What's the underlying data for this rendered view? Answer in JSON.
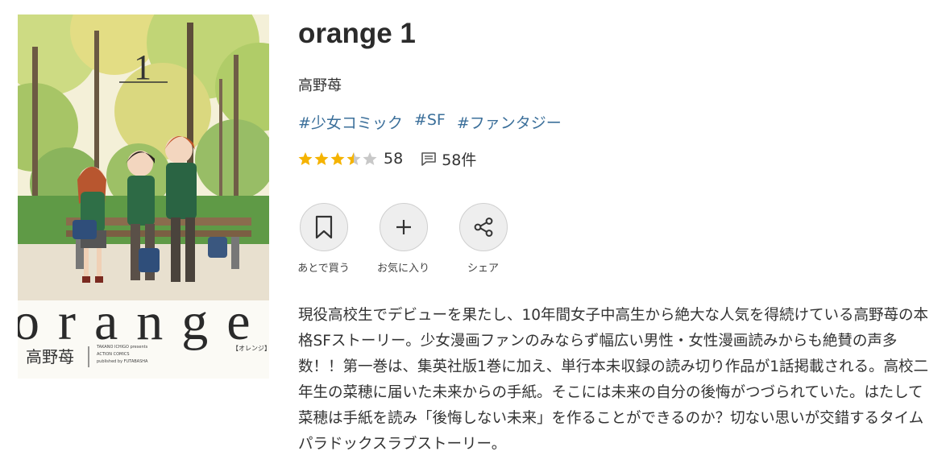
{
  "book": {
    "title": "orange 1",
    "author": "高野苺",
    "tags": [
      "#少女コミック",
      "#SF",
      "#ファンタジー"
    ],
    "rating": 3.5,
    "rating_count": "58",
    "review_count": "58件",
    "description": "現役高校生でデビューを果たし、10年間女子中高生から絶大な人気を得続けている高野苺の本格SFストーリー。少女漫画ファンのみならず幅広い男性・女性漫画読みからも絶賛の声多数！！第一巻は、集英社版1巻に加え、単行本未収録の読み切り作品が1話掲載される。高校二年生の菜穂に届いた未来からの手紙。そこには未来の自分の後悔がつづられていた。はたして菜穂は手紙を読み「後悔しない未来」を作ることができるのか？切ない思いが交錯するタイムパラドックスラブストーリー。"
  },
  "cover": {
    "volume_number": "1",
    "logo": "orange",
    "subtitle": "【オレンジ】",
    "author_name": "高野苺",
    "credit_lines": [
      "TAKANO ICHIGO presents",
      "ACTION COMICS",
      "published by FUTABASHA"
    ]
  },
  "actions": [
    {
      "label": "あとで買う",
      "icon": "bookmark-icon"
    },
    {
      "label": "お気に入り",
      "icon": "plus-icon"
    },
    {
      "label": "シェア",
      "icon": "share-icon"
    }
  ],
  "colors": {
    "tag": "#3b6f9a",
    "star_filled": "#f5b301",
    "star_empty": "#c8c8c8",
    "button_bg": "#eeeeee"
  }
}
